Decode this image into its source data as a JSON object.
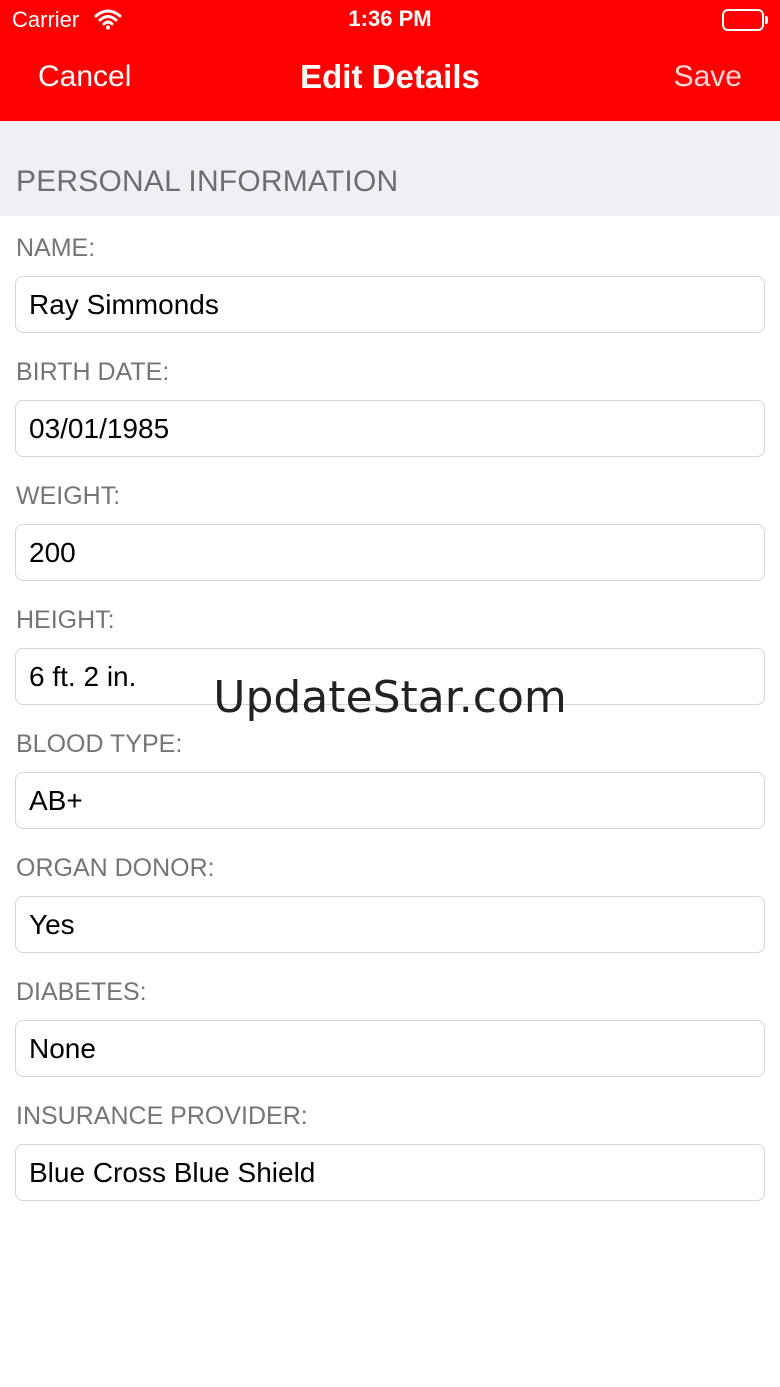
{
  "status_bar": {
    "carrier": "Carrier",
    "wifi_icon": "wifi-icon",
    "time": "1:36 PM",
    "battery_icon": "battery-full-icon"
  },
  "nav": {
    "cancel_label": "Cancel",
    "title": "Edit Details",
    "save_label": "Save"
  },
  "colors": {
    "accent": "#fe0000",
    "section_bg": "#efeff4",
    "label_text": "#757575",
    "input_border": "#d6d6d6"
  },
  "section": {
    "title": "PERSONAL INFORMATION"
  },
  "fields": [
    {
      "label": "NAME:",
      "value": "Ray Simmonds"
    },
    {
      "label": "BIRTH DATE:",
      "value": "03/01/1985"
    },
    {
      "label": "WEIGHT:",
      "value": "200"
    },
    {
      "label": "HEIGHT:",
      "value": "6 ft. 2 in."
    },
    {
      "label": "BLOOD TYPE:",
      "value": "AB+"
    },
    {
      "label": "ORGAN DONOR:",
      "value": "Yes"
    },
    {
      "label": "DIABETES:",
      "value": "None"
    },
    {
      "label": "INSURANCE PROVIDER:",
      "value": "Blue Cross Blue Shield"
    }
  ],
  "watermark": "UpdateStar.com"
}
